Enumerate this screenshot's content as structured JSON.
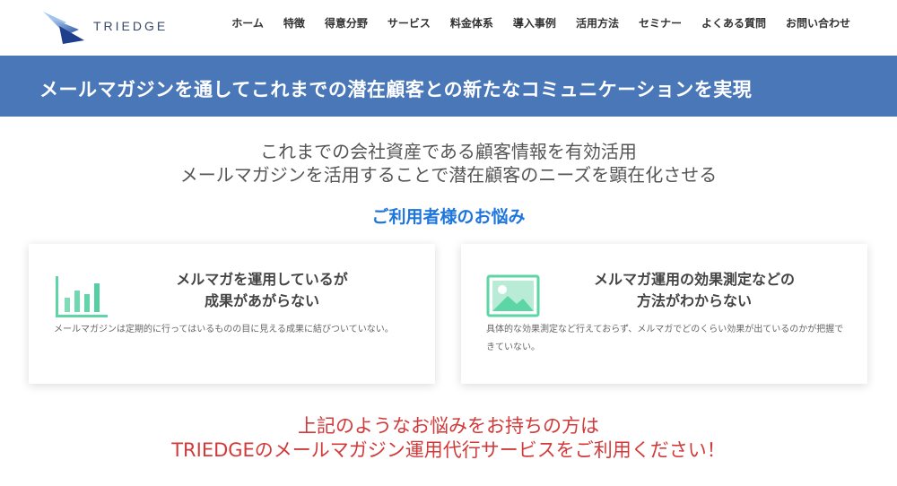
{
  "header": {
    "logo_text": "TRIEDGE",
    "nav": [
      "ホーム",
      "特徴",
      "得意分野",
      "サービス",
      "料金体系",
      "導入事例",
      "活用方法",
      "セミナー",
      "よくある質問",
      "お問い合わせ"
    ]
  },
  "banner": {
    "title": "メールマガジンを通してこれまでの潜在顧客との新たなコミュニケーションを実現"
  },
  "intro": {
    "line1": "これまでの会社資産である顧客情報を有効活用",
    "line2": "メールマガジンを活用することで潜在顧客のニーズを顕在化させる"
  },
  "section_title": "ご利用者様のお悩み",
  "cards": [
    {
      "icon": "bar-chart-icon",
      "title_line1": "メルマガを運用しているが",
      "title_line2": "成果があがらない",
      "description": "メールマガジンは定期的に行ってはいるものの目に見える成果に結びついていない。"
    },
    {
      "icon": "image-icon",
      "title_line1": "メルマガ運用の効果測定などの",
      "title_line2": "方法がわからない",
      "description": "具体的な効果測定など行えておらず、メルマガでどのくらい効果が出ているのかが把握できていない。"
    }
  ],
  "cta": {
    "line1": "上記のようなお悩みをお持ちの方は",
    "line2": "TRIEDGEのメールマガジン運用代行サービスをご利用ください！"
  },
  "colors": {
    "banner": "#4a77b8",
    "section_title": "#1e76dc",
    "cta": "#d23a3a",
    "icon_green": "#5dd6a6"
  }
}
